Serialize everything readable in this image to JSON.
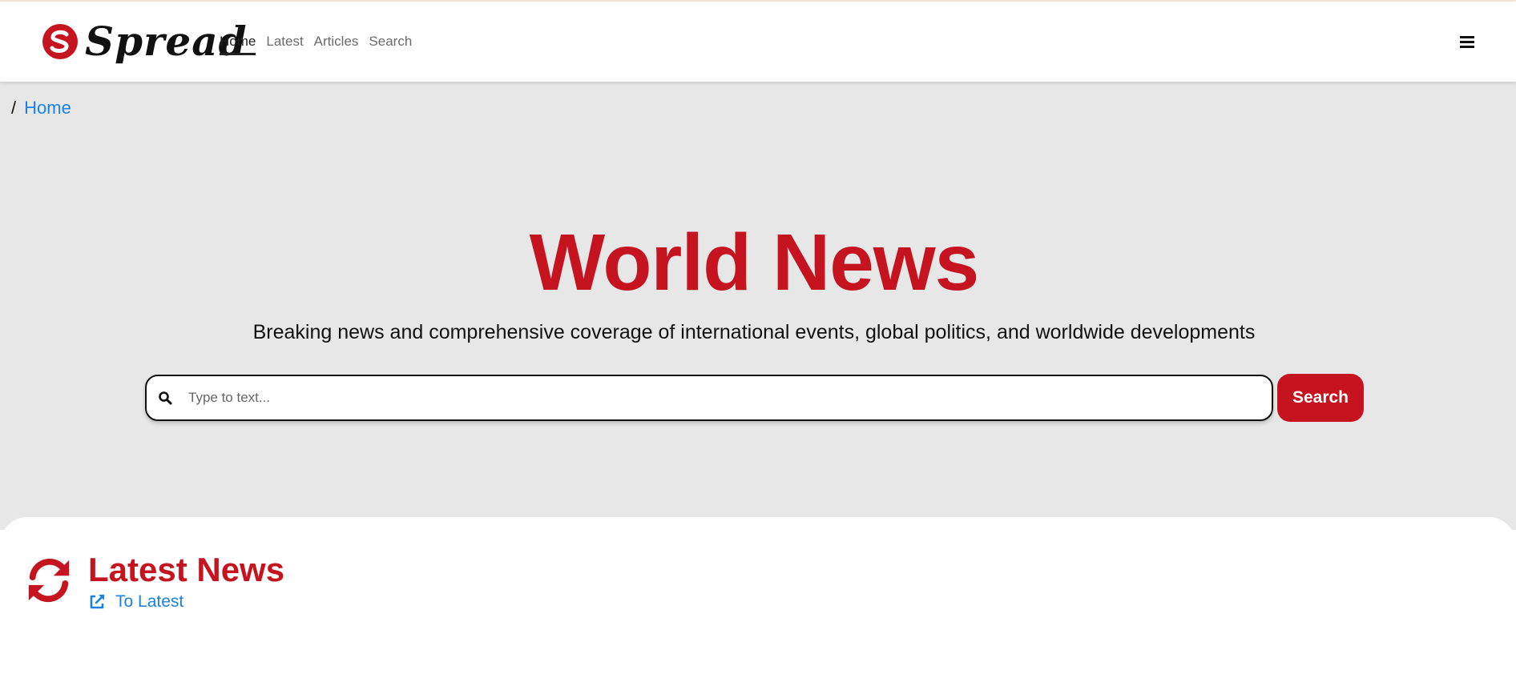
{
  "header": {
    "logo_text": "Spread",
    "nav": [
      {
        "label": "Home",
        "active": true
      },
      {
        "label": "Latest",
        "active": false
      },
      {
        "label": "Articles",
        "active": false
      },
      {
        "label": "Search",
        "active": false
      }
    ],
    "menu_icon": "hamburger-icon"
  },
  "breadcrumb": {
    "separator": "/",
    "items": [
      {
        "label": "Home"
      }
    ]
  },
  "hero": {
    "title": "World News",
    "subtitle": "Breaking news and comprehensive coverage of international events, global politics, and worldwide developments",
    "search": {
      "placeholder": "Type to text...",
      "value": "",
      "button_label": "Search",
      "icon": "search-icon"
    }
  },
  "latest": {
    "title": "Latest News",
    "link_label": "To Latest",
    "section_icon": "refresh-icon",
    "link_icon": "external-link-icon"
  },
  "colors": {
    "brand_red": "#c5141f",
    "link_blue": "#1a82e2",
    "hero_background": "#e7e7e7"
  }
}
